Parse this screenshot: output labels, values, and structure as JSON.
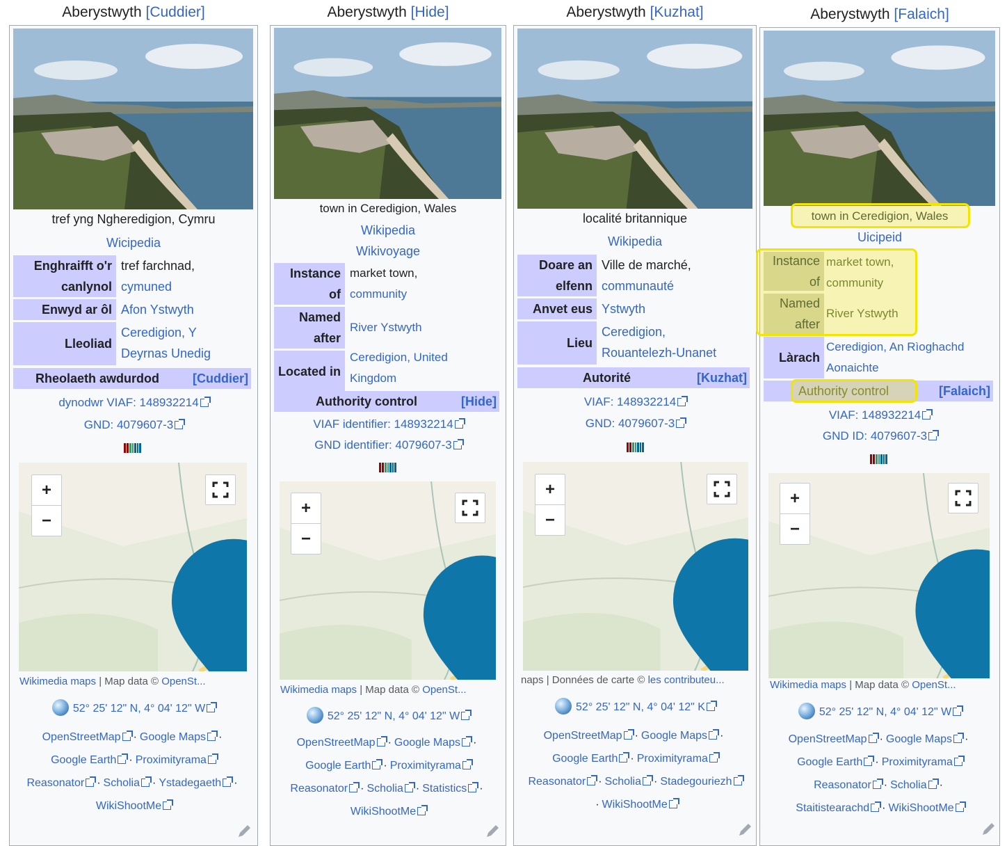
{
  "columns": [
    {
      "title": "Aberystwyth",
      "toggle": "[Cuddier]",
      "description": "tref yng Ngheredigion, Cymru",
      "wiki_links": [
        "Wicipedia"
      ],
      "rows": [
        {
          "label": [
            "Enghraifft o'r",
            "canlynol"
          ],
          "values": [
            "tref farchnad,",
            "cymuned"
          ]
        },
        {
          "label": [
            "Enwyd ar ôl"
          ],
          "values": [
            "Afon Ystwyth"
          ]
        },
        {
          "label": [
            "Lleoliad"
          ],
          "values": [
            "Ceredigion, Y",
            "Deyrnas Unedig"
          ]
        }
      ],
      "authority_label": "Rheolaeth awdurdod",
      "authority_toggle": "[Cuddier]",
      "ids": [
        "dynodwr VIAF: 148932214",
        "GND: 4079607-3"
      ],
      "map_attribution": {
        "link1": "Wikimedia maps",
        "text": " | Map data © ",
        "link2": "OpenSt..."
      },
      "coords": "52° 25' 12\" N, 4° 04' 12\" W",
      "links": [
        [
          "OpenStreetMap",
          "Google Maps"
        ],
        [
          "Google Earth",
          "Proximityrama"
        ],
        [
          "Reasonator",
          "Scholia",
          "Ystadegaeth"
        ],
        [
          "WikiShootMe"
        ]
      ]
    },
    {
      "title": "Aberystwyth",
      "toggle": "[Hide]",
      "description": "town in Ceredigion, Wales",
      "wiki_links": [
        "Wikipedia",
        "Wikivoyage"
      ],
      "rows": [
        {
          "label": [
            "Instance",
            "of"
          ],
          "values": [
            "market town,",
            "community"
          ]
        },
        {
          "label": [
            "Named",
            "after"
          ],
          "values": [
            "River Ystwyth"
          ]
        },
        {
          "label": [
            "Located in"
          ],
          "values": [
            "Ceredigion, United",
            "Kingdom"
          ]
        }
      ],
      "authority_label": "Authority control",
      "authority_toggle": "[Hide]",
      "ids": [
        "VIAF identifier: 148932214",
        "GND identifier: 4079607-3"
      ],
      "map_attribution": {
        "link1": "Wikimedia maps",
        "text": " | Map data © ",
        "link2": "OpenSt..."
      },
      "coords": "52° 25' 12\" N, 4° 04' 12\" W",
      "links": [
        [
          "OpenStreetMap",
          "Google Maps"
        ],
        [
          "Google Earth",
          "Proximityrama"
        ],
        [
          "Reasonator",
          "Scholia",
          "Statistics"
        ],
        [
          "WikiShootMe"
        ]
      ]
    },
    {
      "title": "Aberystwyth",
      "toggle": "[Kuzhat]",
      "description": "localité britannique",
      "wiki_links": [
        "Wikipedia"
      ],
      "rows": [
        {
          "label": [
            "Doare an",
            "elfenn"
          ],
          "values": [
            "Ville de marché,",
            "communauté"
          ]
        },
        {
          "label": [
            "Anvet eus"
          ],
          "values": [
            "Ystwyth"
          ]
        },
        {
          "label": [
            "Lieu"
          ],
          "values": [
            "Ceredigion,",
            "Rouantelezh-Unanet"
          ]
        }
      ],
      "authority_label": "Autorité",
      "authority_toggle": "[Kuzhat]",
      "ids": [
        "VIAF: 148932214",
        "GND: 4079607-3"
      ],
      "map_attribution": {
        "link1": "",
        "text": "naps | Données de carte © ",
        "link2": "les contributeu..."
      },
      "coords": "52° 25' 12\" N, 4° 04' 12\" K",
      "links": [
        [
          "OpenStreetMap",
          "Google Maps"
        ],
        [
          "Google Earth",
          "Proximityrama"
        ],
        [
          "Reasonator",
          "Scholia",
          "Stadegouriezh"
        ],
        [
          "WikiShootMe"
        ]
      ]
    },
    {
      "title": "Aberystwyth",
      "toggle": "[Falaich]",
      "description": "town in Ceredigion, Wales",
      "wiki_links": [
        "Uicipeid"
      ],
      "rows": [
        {
          "label": [
            "Instance",
            "of"
          ],
          "values": [
            "market town,",
            "community"
          ]
        },
        {
          "label": [
            "Named",
            "after"
          ],
          "values": [
            "River Ystwyth"
          ]
        },
        {
          "label": [
            "Làrach"
          ],
          "values": [
            "Ceredigion, An Rìoghachd",
            "Aonaichte"
          ]
        }
      ],
      "authority_label": "Authority control",
      "authority_toggle": "[Falaich]",
      "ids": [
        "VIAF: 148932214",
        "GND ID: 4079607-3"
      ],
      "map_attribution": {
        "link1": "Wikimedia maps",
        "text": " | Map data © ",
        "link2": "OpenSt..."
      },
      "coords": "52° 25' 12\" N, 4° 04' 12\" W",
      "links": [
        [
          "OpenStreetMap",
          "Google Maps"
        ],
        [
          "Google Earth",
          "Proximityrama"
        ],
        [
          "Reasonator",
          "Scholia"
        ],
        [
          "Staitistearachd",
          "WikiShootMe"
        ]
      ]
    }
  ],
  "map_controls": {
    "zoom_in": "+",
    "zoom_out": "−"
  },
  "colors": {
    "link": "#3366cc",
    "header_bg": "#ccccff",
    "highlight": "#f2e600"
  }
}
